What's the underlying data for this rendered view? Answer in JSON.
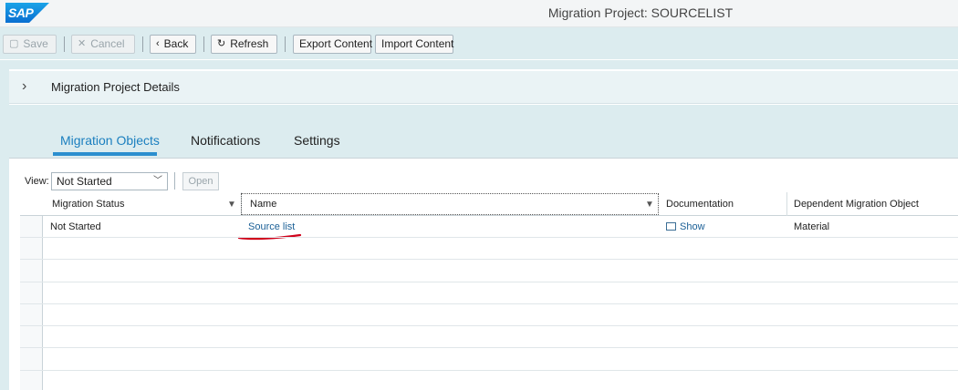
{
  "shell": {
    "logo": "SAP",
    "title": "Migration Project: SOURCELIST"
  },
  "toolbar": {
    "save": "Save",
    "cancel": "Cancel",
    "back": "Back",
    "refresh": "Refresh",
    "export": "Export Content",
    "import": "Import Content"
  },
  "details": {
    "title": "Migration Project Details"
  },
  "tabs": [
    {
      "label": "Migration Objects",
      "active": true
    },
    {
      "label": "Notifications",
      "active": false
    },
    {
      "label": "Settings",
      "active": false
    }
  ],
  "view": {
    "label": "View:",
    "selected": "Not Started",
    "open_button": "Open"
  },
  "table": {
    "columns": [
      "Migration Status",
      "Name",
      "Documentation",
      "Dependent Migration Object"
    ],
    "rows": [
      {
        "status": "Not Started",
        "name": "Source list",
        "documentation": "Show",
        "dependent": "Material"
      }
    ]
  },
  "colors": {
    "accent": "#1b7fbf",
    "annotation": "#d0021b",
    "link": "#1a5f96"
  }
}
